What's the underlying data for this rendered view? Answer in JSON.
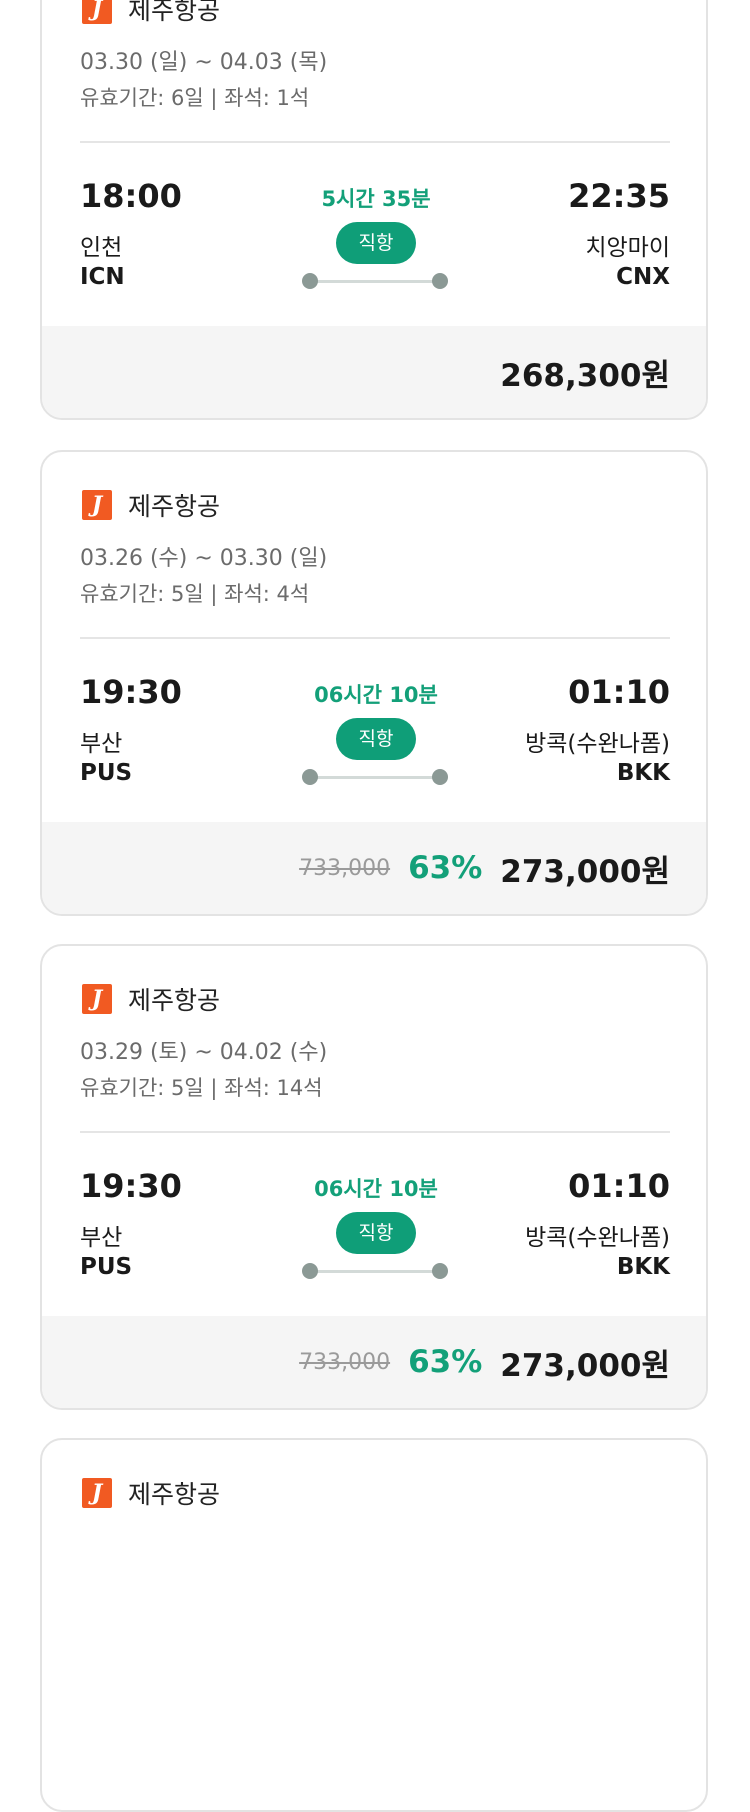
{
  "flights": [
    {
      "airline": "제주항공",
      "airline_logo_letter": "J",
      "dates": "03.30 (일) ~ 04.03 (목)",
      "validity": "유효기간: 6일 | 좌석: 1석",
      "departure": {
        "time": "18:00",
        "city": "인천",
        "code": "ICN"
      },
      "arrival": {
        "time": "22:35",
        "city": "치앙마이",
        "code": "CNX"
      },
      "duration": "5시간 35분",
      "stop_type": "직항",
      "original_price": "",
      "discount": "",
      "price": "268,300원"
    },
    {
      "airline": "제주항공",
      "airline_logo_letter": "J",
      "dates": "03.26 (수) ~ 03.30 (일)",
      "validity": "유효기간: 5일 | 좌석: 4석",
      "departure": {
        "time": "19:30",
        "city": "부산",
        "code": "PUS"
      },
      "arrival": {
        "time": "01:10",
        "city": "방콕(수완나폼)",
        "code": "BKK"
      },
      "duration": "06시간 10분",
      "stop_type": "직항",
      "original_price": "733,000",
      "discount": "63%",
      "price": "273,000원"
    },
    {
      "airline": "제주항공",
      "airline_logo_letter": "J",
      "dates": "03.29 (토) ~ 04.02 (수)",
      "validity": "유효기간: 5일 | 좌석: 14석",
      "departure": {
        "time": "19:30",
        "city": "부산",
        "code": "PUS"
      },
      "arrival": {
        "time": "01:10",
        "city": "방콕(수완나폼)",
        "code": "BKK"
      },
      "duration": "06시간 10분",
      "stop_type": "직항",
      "original_price": "733,000",
      "discount": "63%",
      "price": "273,000원"
    },
    {
      "airline": "제주항공",
      "airline_logo_letter": "J"
    }
  ],
  "colors": {
    "accent_green": "#13a079",
    "badge_green": "#0f9e78",
    "brand_orange": "#f15a22",
    "price_bar_bg": "#f5f5f5",
    "card_border": "#e3e3e3"
  },
  "icons": {
    "airline_logo": "jeju-air-logo-icon",
    "route_endpoint": "route-dot-icon"
  }
}
